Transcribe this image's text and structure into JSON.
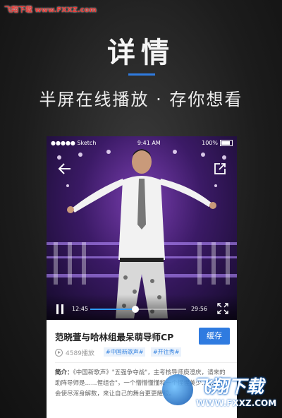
{
  "watermark_top": "飞翔下载 www.FXXZ.com",
  "header": {
    "title": "详情",
    "subtitle": "半屏在线播放 · 存你想看"
  },
  "statusbar": {
    "carrier": "●●●●● Sketch",
    "time": "9:41 AM",
    "battery": "100%"
  },
  "player": {
    "current_time": "12:45",
    "total_time": "29:56",
    "progress_fraction": 0.47
  },
  "video": {
    "title": "范晓萱与哈林组最呆萌导师CP",
    "cache_label": "缓存",
    "views": "4589播放",
    "tags": [
      "#中国新歌声#",
      "#开往秀#"
    ],
    "intro_label": "简介：",
    "intro_text": "《中国新歌声》\"五强争夺战\"，主考核导师庾澄庆，请来的助阵导师是……惺组合\"，一个懵懵懂懂和一个惺惺美少……自然会使尽浑身解数，来让自己的舞台更更耀眼。"
  },
  "watermark_logo": {
    "text": "飞翔下载",
    "url": "WWW.FXXZ.COM"
  },
  "colors": {
    "accent": "#2f7be0",
    "progress": "#2f9bff"
  }
}
